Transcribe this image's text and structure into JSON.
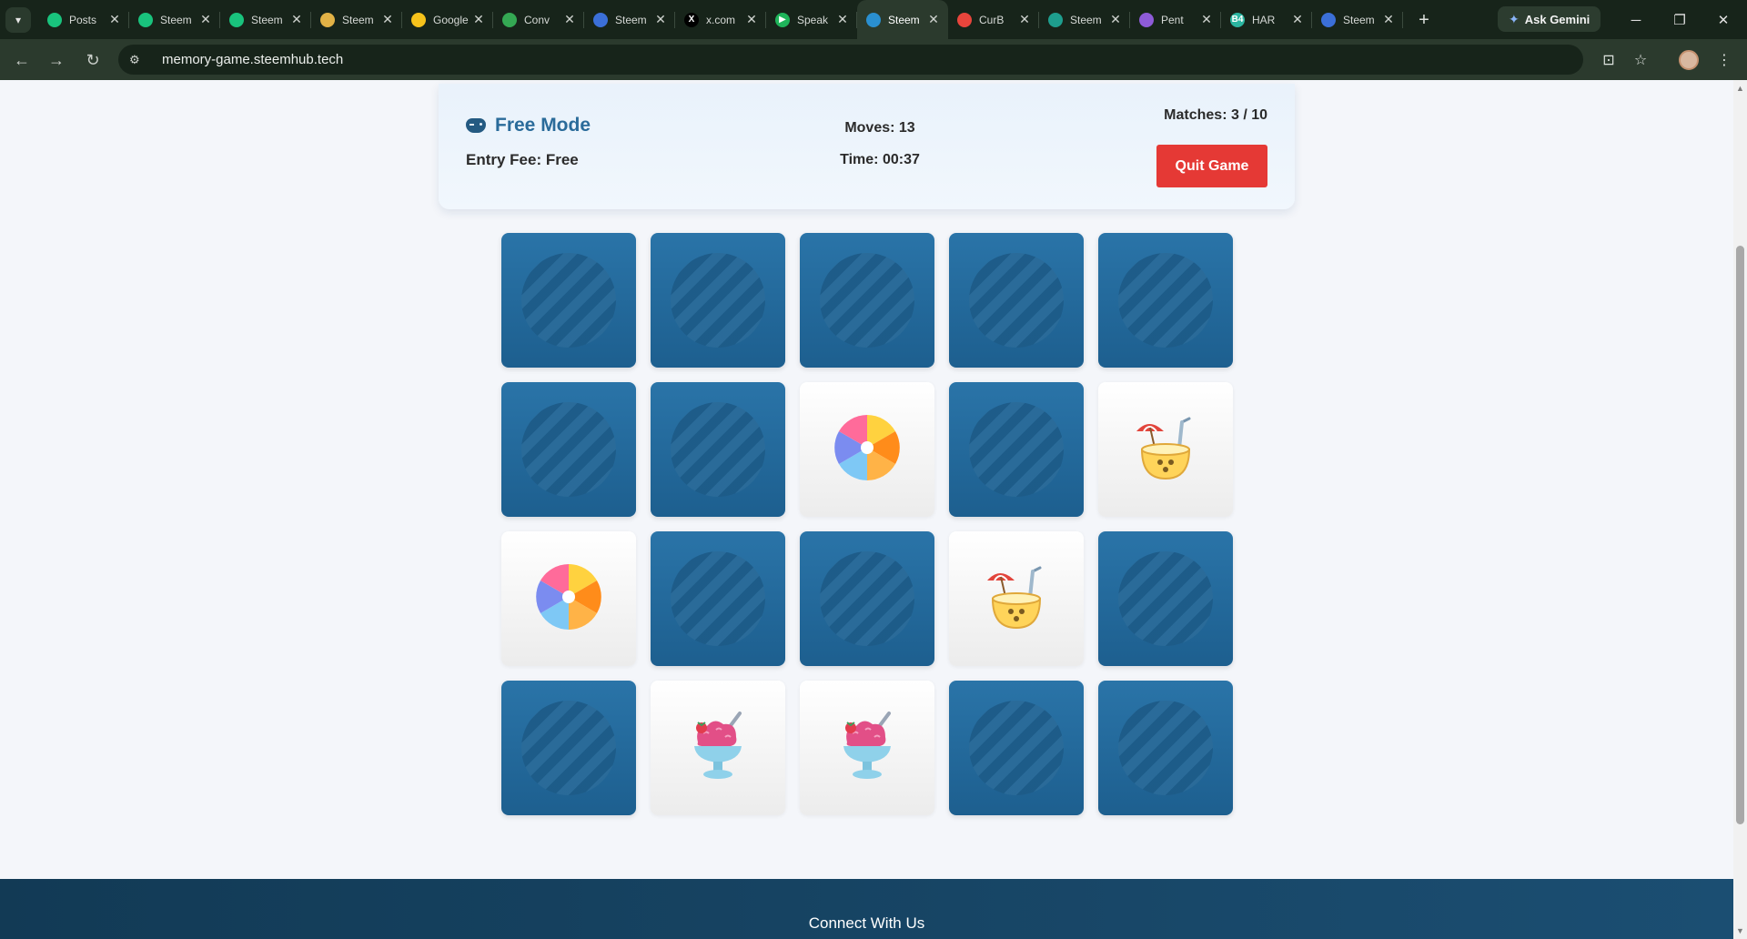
{
  "browser": {
    "tabs": [
      {
        "title": "Posts",
        "color": "#19c37d",
        "glyph": ""
      },
      {
        "title": "Steem",
        "color": "#19c37d",
        "glyph": ""
      },
      {
        "title": "Steem",
        "color": "#19c37d",
        "glyph": ""
      },
      {
        "title": "Steem",
        "color": "#e2b246",
        "glyph": ""
      },
      {
        "title": "Google",
        "color": "#f6c21b",
        "glyph": ""
      },
      {
        "title": "Conv",
        "color": "#34a853",
        "glyph": ""
      },
      {
        "title": "Steem",
        "color": "#3b6fd8",
        "glyph": ""
      },
      {
        "title": "x.com",
        "color": "#000000",
        "glyph": "X"
      },
      {
        "title": "Speak",
        "color": "#1fb45a",
        "glyph": "▶"
      },
      {
        "title": "Steem",
        "color": "#2a8fd0",
        "glyph": ""
      },
      {
        "title": "CurB",
        "color": "#e8453c",
        "glyph": ""
      },
      {
        "title": "Steem",
        "color": "#1e9e8e",
        "glyph": ""
      },
      {
        "title": "Pent",
        "color": "#8e5bd8",
        "glyph": ""
      },
      {
        "title": "HAR",
        "color": "#2bb5a0",
        "glyph": "B4"
      },
      {
        "title": "Steem",
        "color": "#3b6fd8",
        "glyph": ""
      }
    ],
    "active_tab": 9,
    "gemini_label": "Ask Gemini",
    "url": "memory-game.steemhub.tech"
  },
  "game": {
    "mode": "Free Mode",
    "entry_fee": "Entry Fee: Free",
    "moves": "Moves: 13",
    "time": "Time: 00:37",
    "matches": "Matches: 3 / 10",
    "quit_label": "Quit Game"
  },
  "board": {
    "rows": 4,
    "cols": 5,
    "cards": [
      "down",
      "down",
      "down",
      "down",
      "down",
      "down",
      "down",
      "beach-ball",
      "down",
      "coconut-drink",
      "beach-ball",
      "down",
      "down",
      "coconut-drink",
      "down",
      "down",
      "ice-cream",
      "ice-cream",
      "down",
      "down"
    ]
  },
  "footer": {
    "connect": "Connect With Us"
  },
  "colors": {
    "card_back": "#2a74a8",
    "accent": "#2a6b9a",
    "quit": "#e53935",
    "footer": "#163f5e"
  }
}
